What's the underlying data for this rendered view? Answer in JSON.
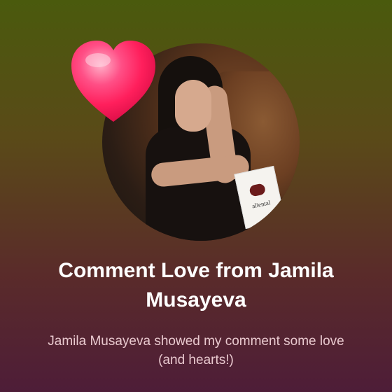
{
  "card": {
    "title": "Comment Love from Jamila Musayeva",
    "subtitle": "Jamila Musayeva showed my comment some love (and hearts!)",
    "product_box_text": "aliental"
  },
  "icons": {
    "reaction": "heart-icon"
  },
  "colors": {
    "heart": "#ff2f6b",
    "title_text": "#ffffff",
    "subtitle_text": "#e9c9cf"
  }
}
